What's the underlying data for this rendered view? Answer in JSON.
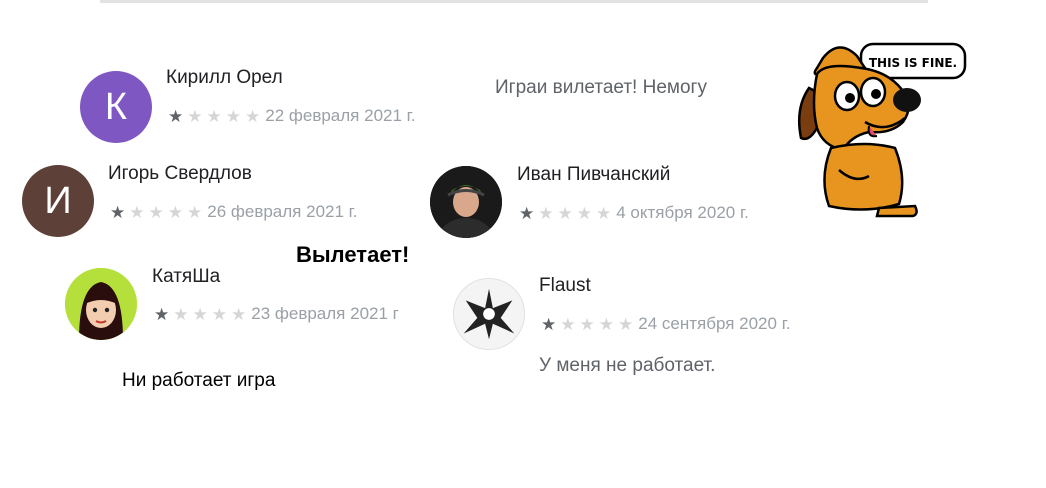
{
  "reviews": [
    {
      "author": "Кирилл Орел",
      "initial": "К",
      "avatar_color": "#7e57c2",
      "stars_filled": 1,
      "stars_total": 5,
      "date": "22 февраля 2021 г.",
      "comment": "Играи вилетает! Немогу"
    },
    {
      "author": "Игорь Свердлов",
      "initial": "И",
      "avatar_color": "#5d4037",
      "stars_filled": 1,
      "stars_total": 5,
      "date": "26 февраля 2021 г."
    },
    {
      "author": "Иван Пивчанский",
      "stars_filled": 1,
      "stars_total": 5,
      "date": "4 октября 2020 г."
    },
    {
      "author": "КатяШа",
      "stars_filled": 1,
      "stars_total": 5,
      "date": "23 февраля 2021 г"
    },
    {
      "author": "Flaust",
      "stars_filled": 1,
      "stars_total": 5,
      "date": "24 сентября 2020 г.",
      "comment": "У меня не работает."
    }
  ],
  "annotations": {
    "bold_note": "Вылетает!",
    "katya_note": "Ни работает игра"
  },
  "meme": {
    "speech": "THIS IS FINE."
  }
}
